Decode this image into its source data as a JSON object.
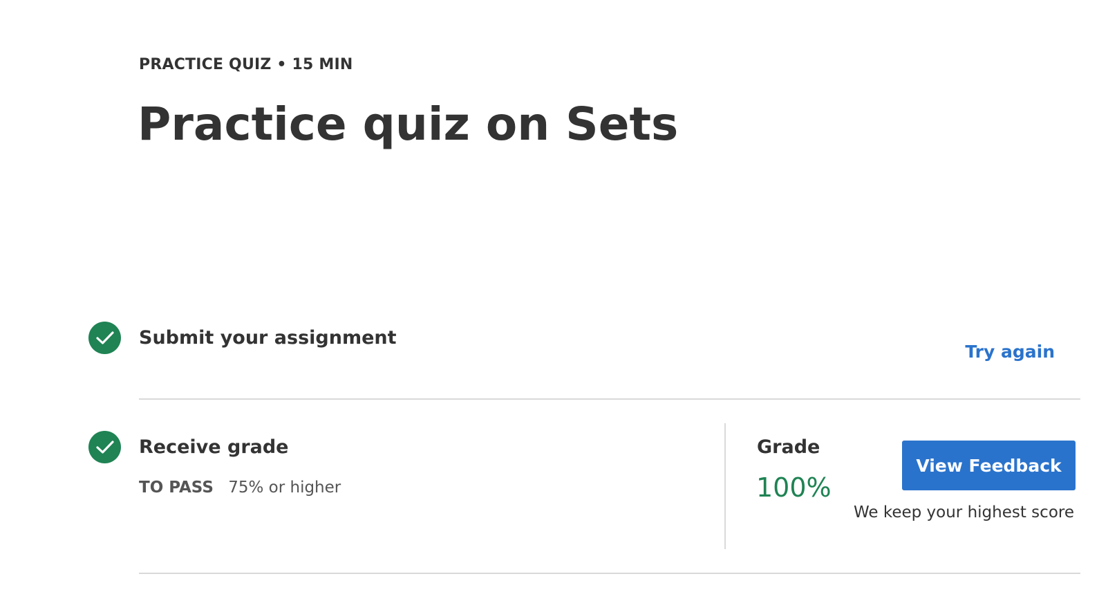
{
  "header": {
    "eyebrow": "PRACTICE QUIZ • 15 MIN",
    "title": "Practice quiz on Sets"
  },
  "steps": {
    "submit": {
      "title": "Submit your assignment",
      "icon": "checkmark-circle-icon",
      "completed": true,
      "action_label": "Try again"
    },
    "receive_grade": {
      "title": "Receive grade",
      "icon": "checkmark-circle-icon",
      "completed": true,
      "pass_label": "TO PASS",
      "pass_value": "75% or higher"
    }
  },
  "grade": {
    "label": "Grade",
    "value": "100%",
    "button_label": "View Feedback",
    "note": "We keep your highest score"
  },
  "colors": {
    "success": "#1f8354",
    "accent": "#2a73cc",
    "text": "#333333",
    "divider": "#d9d9d9"
  }
}
